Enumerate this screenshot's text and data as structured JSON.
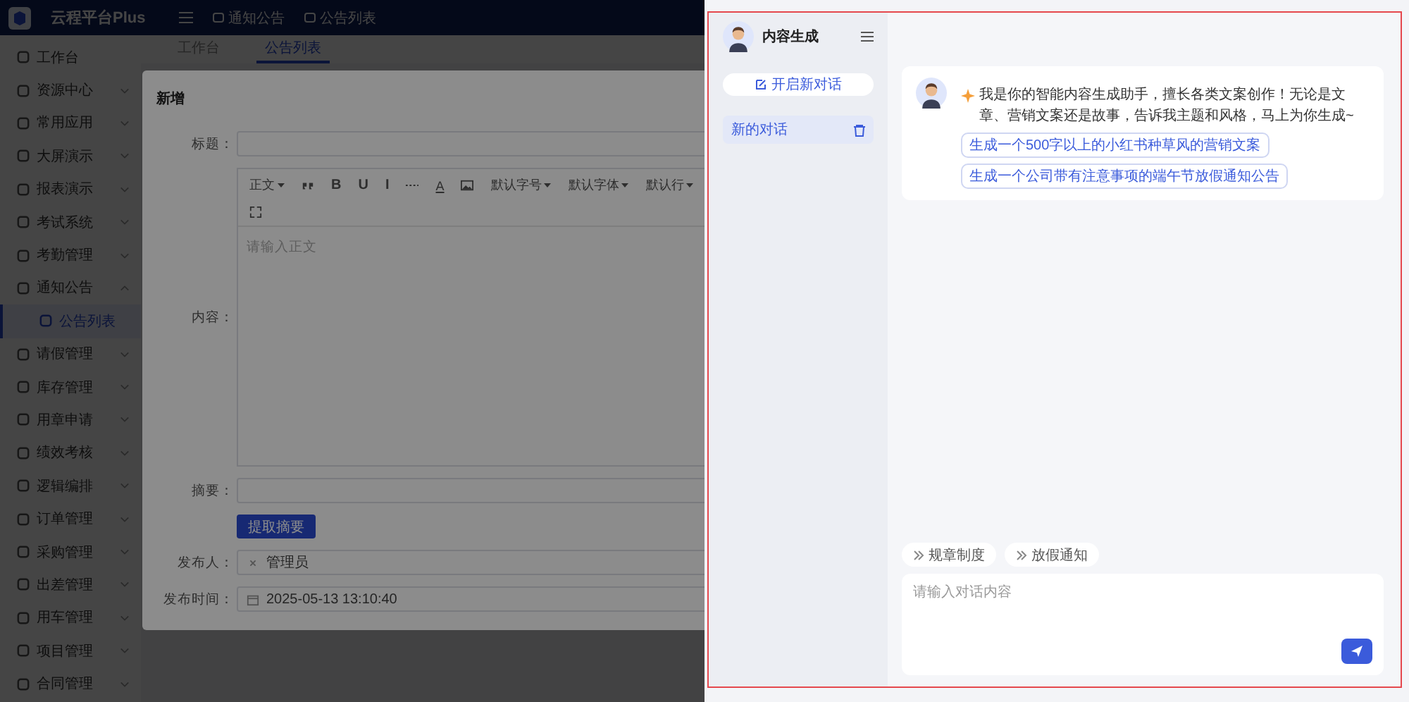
{
  "app": {
    "title": "云程平台Plus",
    "header_tabs": [
      {
        "label": "通知公告"
      },
      {
        "label": "公告列表"
      }
    ],
    "page_tabs": [
      {
        "label": "工作台",
        "selected": false
      },
      {
        "label": "公告列表",
        "selected": true
      }
    ],
    "sidebar": [
      {
        "label": "工作台",
        "selected": false
      },
      {
        "label": "资源中心",
        "expanded": false,
        "selected": false
      },
      {
        "label": "常用应用",
        "expanded": false,
        "selected": false
      },
      {
        "label": "大屏演示",
        "expanded": false,
        "selected": false
      },
      {
        "label": "报表演示",
        "expanded": false,
        "selected": false
      },
      {
        "label": "考试系统",
        "expanded": false,
        "selected": false
      },
      {
        "label": "考勤管理",
        "expanded": false,
        "selected": false
      },
      {
        "label": "通知公告",
        "expanded": true,
        "selected": false,
        "children": [
          {
            "label": "公告列表",
            "selected": true
          }
        ]
      },
      {
        "label": "请假管理",
        "expanded": false,
        "selected": false
      },
      {
        "label": "库存管理",
        "expanded": false,
        "selected": false
      },
      {
        "label": "用章申请",
        "expanded": false,
        "selected": false
      },
      {
        "label": "绩效考核",
        "expanded": false,
        "selected": false
      },
      {
        "label": "逻辑编排",
        "expanded": false,
        "selected": false
      },
      {
        "label": "订单管理",
        "expanded": false,
        "selected": false
      },
      {
        "label": "采购管理",
        "expanded": false,
        "selected": false
      },
      {
        "label": "出差管理",
        "expanded": false,
        "selected": false
      },
      {
        "label": "用车管理",
        "expanded": false,
        "selected": false
      },
      {
        "label": "项目管理",
        "expanded": false,
        "selected": false
      },
      {
        "label": "合同管理",
        "expanded": false,
        "selected": false
      }
    ]
  },
  "dialog": {
    "title": "新增",
    "fields": [
      {
        "kind": "input",
        "label": "标题："
      },
      {
        "kind": "editor",
        "label": "内容：",
        "placeholder": "请输入正文",
        "toolbar": [
          {
            "kind": "dropdown",
            "label": "正文"
          },
          {
            "kind": "quote"
          },
          {
            "kind": "glyph",
            "label": "B"
          },
          {
            "kind": "glyph",
            "label": "U"
          },
          {
            "kind": "glyph",
            "label": "I"
          },
          {
            "kind": "more"
          },
          {
            "kind": "color",
            "label": "A"
          },
          {
            "kind": "image"
          },
          {
            "kind": "dropdown",
            "label": "默认字号"
          },
          {
            "kind": "dropdown",
            "label": "默认字体"
          },
          {
            "kind": "dropdown",
            "label": "默认行"
          },
          {
            "kind": "fullscreen"
          }
        ]
      },
      {
        "kind": "input",
        "label": "摘要："
      },
      {
        "kind": "button",
        "label": "提取摘要"
      },
      {
        "kind": "tag",
        "label": "发布人：",
        "value": "管理员"
      },
      {
        "kind": "datetime",
        "label": "发布时间：",
        "value": "2025-05-13 13:10:40"
      }
    ]
  },
  "chat": {
    "title": "内容生成",
    "new_chat": "开启新对话",
    "conversations": [
      {
        "label": "新的对话",
        "selected": true
      }
    ],
    "messages": [
      {
        "text": "我是你的智能内容生成助手，擅长各类文案创作！无论是文章、营销文案还是故事，告诉我主题和风格，马上为你生成~",
        "suggestions": [
          "生成一个500字以上的小红书种草风的营销文案",
          "生成一个公司带有注意事项的端午节放假通知公告"
        ]
      }
    ],
    "quick_actions": [
      {
        "label": "规章制度"
      },
      {
        "label": "放假通知"
      }
    ],
    "input": {
      "placeholder": "请输入对话内容"
    }
  }
}
